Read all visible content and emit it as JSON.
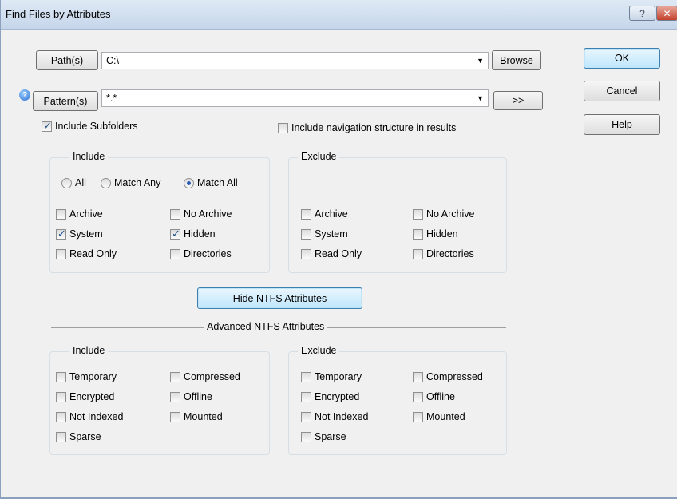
{
  "window": {
    "title": "Find Files by Attributes",
    "help_btn": "?",
    "close_btn": "✕"
  },
  "paths": {
    "button": "Path(s)",
    "value": "C:\\",
    "browse": "Browse"
  },
  "patterns": {
    "button": "Pattern(s)",
    "value": "*.*",
    "more": ">>"
  },
  "dialog_buttons": {
    "ok": "OK",
    "cancel": "Cancel",
    "help": "Help"
  },
  "options": {
    "include_subfolders": {
      "label": "Include Subfolders",
      "checked": true
    },
    "include_navigation": {
      "label": "Include navigation structure in results",
      "checked": false
    }
  },
  "include": {
    "title": "Include",
    "match": {
      "all": "All",
      "any": "Match Any",
      "match_all": "Match All",
      "selected": "match_all"
    },
    "attrs": {
      "archive": {
        "label": "Archive",
        "checked": false
      },
      "no_archive": {
        "label": "No Archive",
        "checked": false
      },
      "system": {
        "label": "System",
        "checked": true
      },
      "hidden": {
        "label": "Hidden",
        "checked": true
      },
      "read_only": {
        "label": "Read Only",
        "checked": false
      },
      "directories": {
        "label": "Directories",
        "checked": false
      }
    }
  },
  "exclude": {
    "title": "Exclude",
    "attrs": {
      "archive": {
        "label": "Archive",
        "checked": false
      },
      "no_archive": {
        "label": "No Archive",
        "checked": false
      },
      "system": {
        "label": "System",
        "checked": false
      },
      "hidden": {
        "label": "Hidden",
        "checked": false
      },
      "read_only": {
        "label": "Read Only",
        "checked": false
      },
      "directories": {
        "label": "Directories",
        "checked": false
      }
    }
  },
  "ntfs_toggle": "Hide NTFS Attributes",
  "ntfs": {
    "title": "Advanced NTFS Attributes",
    "include": {
      "title": "Include",
      "temporary": "Temporary",
      "compressed": "Compressed",
      "encrypted": "Encrypted",
      "offline": "Offline",
      "not_indexed": "Not Indexed",
      "mounted": "Mounted",
      "sparse": "Sparse"
    },
    "exclude": {
      "title": "Exclude",
      "temporary": "Temporary",
      "compressed": "Compressed",
      "encrypted": "Encrypted",
      "offline": "Offline",
      "not_indexed": "Not Indexed",
      "mounted": "Mounted",
      "sparse": "Sparse"
    }
  },
  "colors": {
    "titlebar": "#c5d6ea",
    "dialog_bg": "#f0f0f0",
    "accent": "#3c7fb1",
    "close": "#c4412c"
  }
}
